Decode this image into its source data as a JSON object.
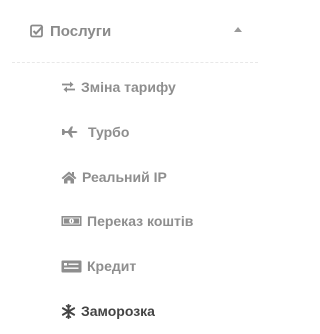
{
  "section": {
    "label": "Послуги",
    "icon": "checkbox-icon",
    "expanded": true
  },
  "items": [
    {
      "label": "Зміна тарифу",
      "icon": "exchange-icon"
    },
    {
      "label": "Турбо",
      "icon": "plane-icon"
    },
    {
      "label": "Реальний IP",
      "icon": "home-icon"
    },
    {
      "label": "Переказ коштів",
      "icon": "money-icon"
    },
    {
      "label": "Кредит",
      "icon": "credit-card-icon"
    },
    {
      "label": "Заморозка",
      "icon": "snowflake-icon",
      "active": true
    }
  ],
  "colors": {
    "text": "#8e8e8e",
    "active_text": "#444444",
    "divider": "#e8e8e8"
  }
}
